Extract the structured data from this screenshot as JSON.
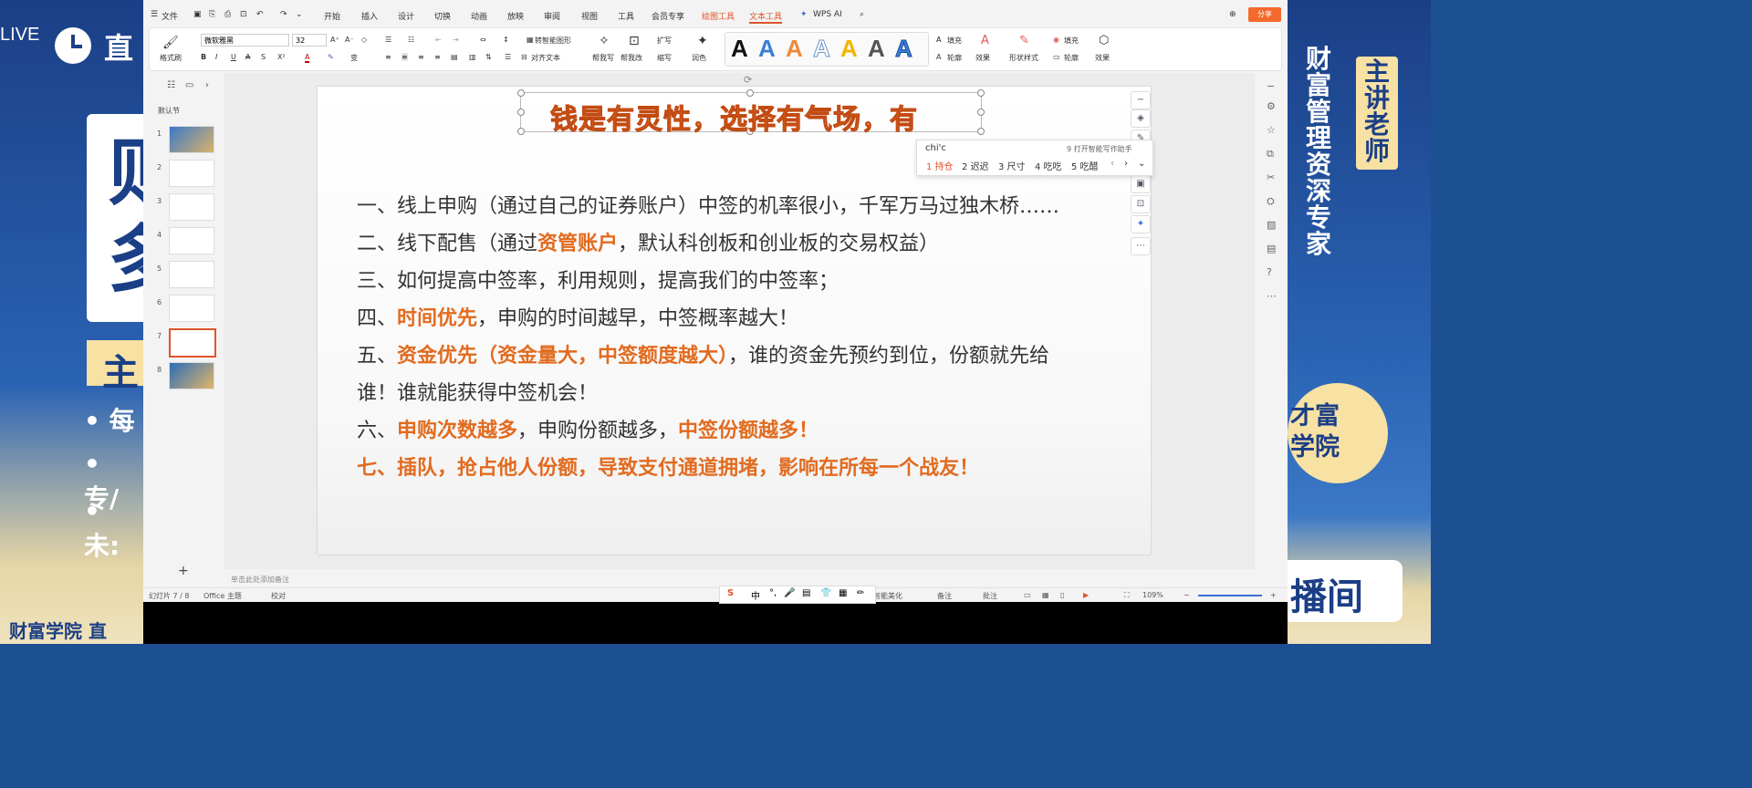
{
  "stream": {
    "live_label": "LIVE",
    "brand_left": "直",
    "big_chars": [
      "则",
      "多"
    ],
    "zhu": "主",
    "bullets": [
      "• 每",
      "• 专/",
      "• 未:"
    ],
    "footer_left": "财富学院 直",
    "right_vertical": [
      "财",
      "富",
      "管",
      "理",
      "资",
      "深",
      "专",
      "家"
    ],
    "teacher": [
      "主",
      "讲",
      "老",
      "师"
    ],
    "badge_lines": [
      "才富",
      "学院"
    ],
    "bo": "播间"
  },
  "menu": {
    "file": "文件",
    "tabs": [
      "开始",
      "插入",
      "设计",
      "切换",
      "动画",
      "放映",
      "审阅",
      "视图",
      "工具",
      "会员专享",
      "绘图工具",
      "文本工具",
      "WPS AI"
    ],
    "active_tab": "文本工具",
    "share": "分享"
  },
  "ribbon": {
    "format_painter": "格式刷",
    "font_name": "微软雅黑",
    "font_size": "32",
    "smart_layout": "转智能图形",
    "align_text": "对齐文本",
    "help_write": "帮我写",
    "help_modify": "帮我改",
    "expand": "扩写",
    "shorten": "缩写",
    "polish": "润色",
    "fill": "填充",
    "outline": "轮廓",
    "effect": "效果",
    "shape_style": "形状样式",
    "fill2": "填充",
    "outline2": "轮廓",
    "effect2": "效果"
  },
  "colors": {
    "accent": "#e26b1f",
    "title_fill": "#f08a3a",
    "title_stroke": "#c24a12",
    "stream_blue": "#1b3f86",
    "stream_gold": "#f7e1a3"
  },
  "thumbs": {
    "section": "默认节",
    "numbers": [
      "1",
      "2",
      "3",
      "4",
      "5",
      "6",
      "7",
      "8"
    ],
    "selected": "7",
    "add": "+"
  },
  "slide": {
    "title": "钱是有灵性，选择有气场，有",
    "lines": [
      {
        "parts": [
          "一、线上申购（通过自己的证券账户）中签的机率很小，千军万马过独木桥……"
        ]
      },
      {
        "parts": [
          "二、线下配售（通过",
          "资管账户",
          "，默认科创板和创业板的交易权益）"
        ]
      },
      {
        "parts": [
          "三、如何提高中签率，利用规则，提高我们的中签率；"
        ]
      },
      {
        "parts": [
          "四、",
          "时间优先",
          "，申购的时间越早，中签概率越大！"
        ]
      },
      {
        "parts": [
          "五、",
          "资金优先（资金量大，中签额度越大）",
          "，谁的资金先预约到位，份额就先给"
        ]
      },
      {
        "parts": [
          "谁！谁就能获得中签机会！"
        ]
      },
      {
        "parts": [
          "六、",
          "申购次数越多",
          "，申购份额越多，",
          "中签份额越多！"
        ]
      },
      {
        "parts": [
          "七、插队，抢占他人份额，导致支付通道拥堵，影响在所每一个战友！"
        ]
      }
    ]
  },
  "ime": {
    "input": "chi'c",
    "assistant": "9 打开智能写作助手",
    "candidates": [
      "1 持仓",
      "2 迟迟",
      "3 尺寸",
      "4 吃吃",
      "5 吃醋"
    ]
  },
  "notes_placeholder": "单击此处添加备注",
  "status": {
    "slide_pos": "幻灯片 7 / 8",
    "theme": "Office 主题",
    "proof": "校对",
    "beautify": "智能美化",
    "notes": "备注",
    "annot": "批注",
    "zoom": "109%"
  },
  "ime_bar": [
    "S",
    "中",
    "°,",
    "🎤",
    "▤",
    "👕",
    "▦",
    "✏"
  ]
}
